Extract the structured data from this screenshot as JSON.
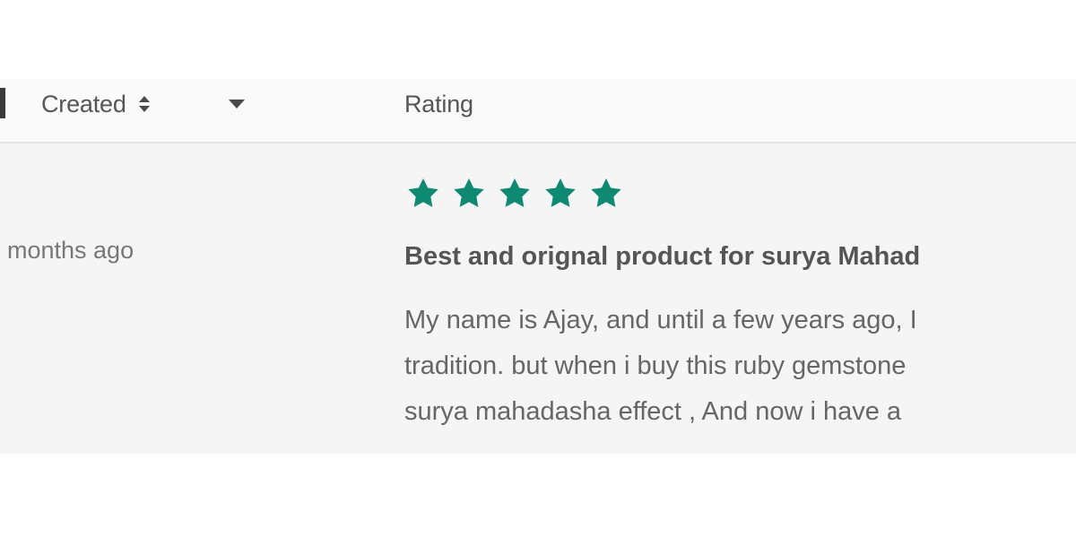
{
  "table": {
    "columns": {
      "created": {
        "label": "Created",
        "sort_icon": "sort-up-down-icon",
        "filter_icon": "caret-down-icon"
      },
      "rating": {
        "label": "Rating"
      }
    },
    "rows": [
      {
        "created": "months ago",
        "rating_stars": 5,
        "rating_max": 5,
        "title": "Best and orignal product for surya Mahad",
        "body_lines": [
          "My name is Ajay, and until a few years ago, I",
          "tradition. but when i buy this ruby gemstone",
          "surya mahadasha effect , And now i have a"
        ]
      }
    ]
  },
  "colors": {
    "star": "#0f8a72",
    "header_background": "#fafafa",
    "row_background": "#f5f5f5"
  }
}
